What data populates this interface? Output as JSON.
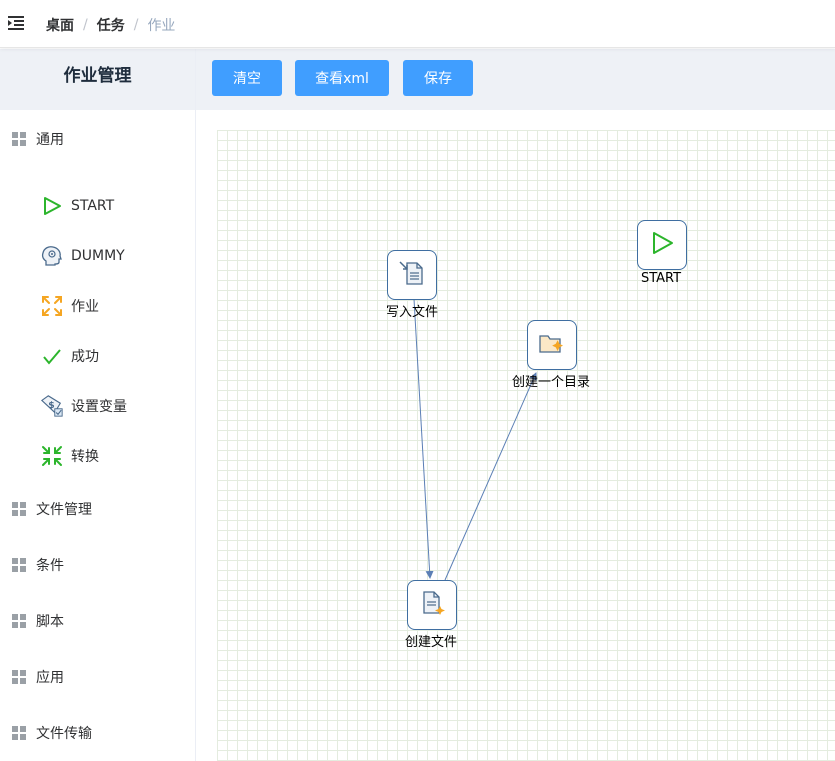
{
  "header": {
    "breadcrumb": [
      {
        "label": "桌面"
      },
      {
        "label": "任务"
      },
      {
        "label": "作业"
      }
    ],
    "separator": "/"
  },
  "sidebar": {
    "title": "作业管理",
    "categories": [
      {
        "label": "通用",
        "icon": "grid-icon",
        "expanded": true,
        "items": [
          {
            "label": "START",
            "icon": "start-icon"
          },
          {
            "label": "DUMMY",
            "icon": "dummy-head-icon"
          },
          {
            "label": "作业",
            "icon": "job-arrows-icon"
          },
          {
            "label": "成功",
            "icon": "success-check-icon"
          },
          {
            "label": "设置变量",
            "icon": "set-variable-icon"
          },
          {
            "label": "转换",
            "icon": "transform-arrows-icon"
          }
        ]
      },
      {
        "label": "文件管理",
        "icon": "grid-icon"
      },
      {
        "label": "条件",
        "icon": "grid-icon"
      },
      {
        "label": "脚本",
        "icon": "grid-icon"
      },
      {
        "label": "应用",
        "icon": "grid-icon"
      },
      {
        "label": "文件传输",
        "icon": "grid-icon"
      }
    ]
  },
  "toolbar": {
    "clear_label": "清空",
    "view_xml_label": "查看xml",
    "save_label": "保存"
  },
  "canvas": {
    "nodes": [
      {
        "id": "write-file",
        "label": "写入文件",
        "icon": "write-file-icon"
      },
      {
        "id": "create-dir",
        "label": "创建一个目录",
        "icon": "create-folder-icon"
      },
      {
        "id": "start",
        "label": "START",
        "icon": "start-icon"
      },
      {
        "id": "create-file",
        "label": "创建文件",
        "icon": "create-file-icon"
      }
    ],
    "edges": [
      {
        "from": "write-file",
        "to": "create-file"
      },
      {
        "from": "create-file",
        "to": "create-dir"
      }
    ]
  },
  "colors": {
    "primary": "#409eff",
    "node_border": "#3f6ea1",
    "edge": "#5b7fb5",
    "start_green": "#2cb52c",
    "job_orange": "#f5a623",
    "grid_line": "#e4ecdf"
  }
}
